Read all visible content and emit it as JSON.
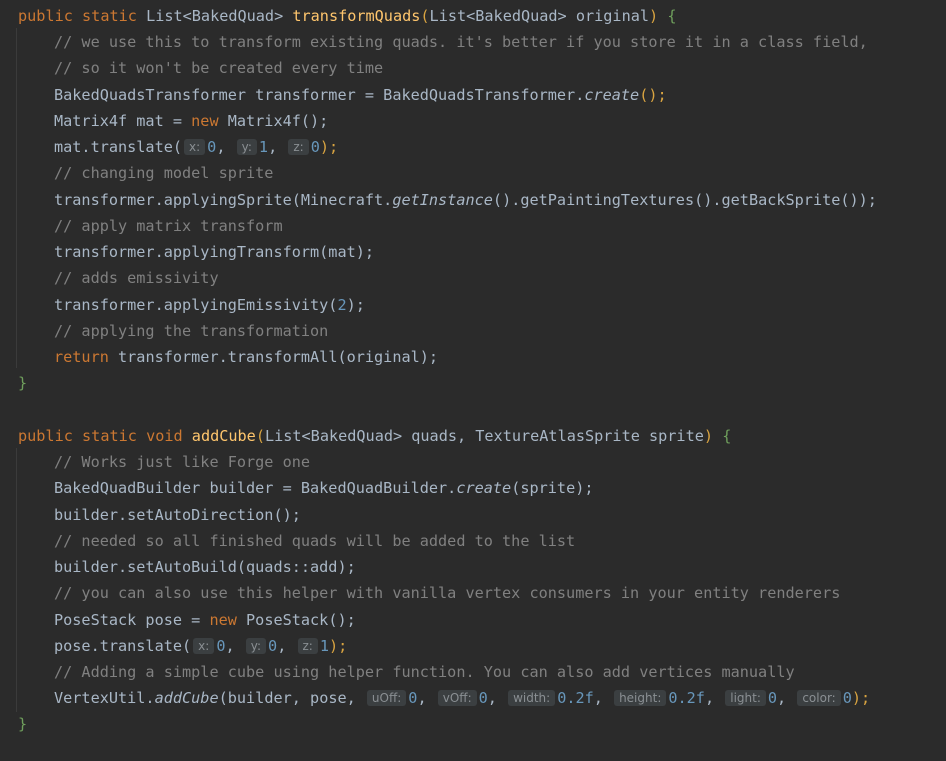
{
  "editor": {
    "colors": {
      "background": "#2b2b2b",
      "text": "#a9b7c6",
      "keyword": "#cc7832",
      "function": "#ffc66d",
      "comment": "#808080",
      "number": "#6897bb",
      "hint_bg": "#3b3f41"
    },
    "method1": {
      "sig_public": "public",
      "sig_static": "static",
      "sig_rtype": "List<BakedQuad>",
      "sig_name": "transformQuads",
      "sig_params": "List<BakedQuad> original",
      "sig_brace": "{",
      "c1": "// we use this to transform existing quads. it's better if you store it in a class field,",
      "c2": "// so it won't be created every time",
      "l3_a": "BakedQuadsTransformer transformer = BakedQuadsTransformer.",
      "l3_b": "create",
      "l3_c": "();",
      "l4_a": "Matrix4f mat = ",
      "l4_new": "new",
      "l4_b": " Matrix4f();",
      "l5_a": "mat.translate(",
      "l5_hx": "x:",
      "l5_x": "0",
      "l5_hy": "y:",
      "l5_y": "1",
      "l5_hz": "z:",
      "l5_z": "0",
      "l5_end": ");",
      "c6": "// changing model sprite",
      "l7_a": "transformer.applyingSprite(Minecraft.",
      "l7_b": "getInstance",
      "l7_c": "().getPaintingTextures().getBackSprite());",
      "c8": "// apply matrix transform",
      "l9": "transformer.applyingTransform(mat);",
      "c10": "// adds emissivity",
      "l11_a": "transformer.applyingEmissivity(",
      "l11_n": "2",
      "l11_b": ");",
      "c12": "// applying the transformation",
      "l13_ret": "return",
      "l13_b": " transformer.transformAll(original);",
      "close": "}"
    },
    "method2": {
      "sig_public": "public",
      "sig_static": "static",
      "sig_void": "void",
      "sig_name": "addCube",
      "sig_params": "List<BakedQuad> quads, TextureAtlasSprite sprite",
      "sig_brace": "{",
      "c1": "// Works just like Forge one",
      "l2_a": "BakedQuadBuilder builder = BakedQuadBuilder.",
      "l2_b": "create",
      "l2_c": "(sprite);",
      "l3": "builder.setAutoDirection();",
      "c4": "// needed so all finished quads will be added to the list",
      "l5": "builder.setAutoBuild(quads::add);",
      "c6": "// you can also use this helper with vanilla vertex consumers in your entity renderers",
      "l7_a": "PoseStack pose = ",
      "l7_new": "new",
      "l7_b": " PoseStack();",
      "l8_a": "pose.translate(",
      "l8_hx": "x:",
      "l8_x": "0",
      "l8_hy": "y:",
      "l8_y": "0",
      "l8_hz": "z:",
      "l8_z": "1",
      "l8_end": ");",
      "c9": "// Adding a simple cube using helper function. You can also add vertices manually",
      "l10_a": "VertexUtil.",
      "l10_b": "addCube",
      "l10_c": "(builder, pose, ",
      "h_uoff": "uOff:",
      "v_uoff": "0",
      "h_voff": "vOff:",
      "v_voff": "0",
      "h_width": "width:",
      "v_width": "0.2f",
      "h_height": "height:",
      "v_height": "0.2f",
      "h_light": "light:",
      "v_light": "0",
      "h_color": "color:",
      "v_color": "0",
      "l10_end": ");",
      "close": "}"
    }
  }
}
